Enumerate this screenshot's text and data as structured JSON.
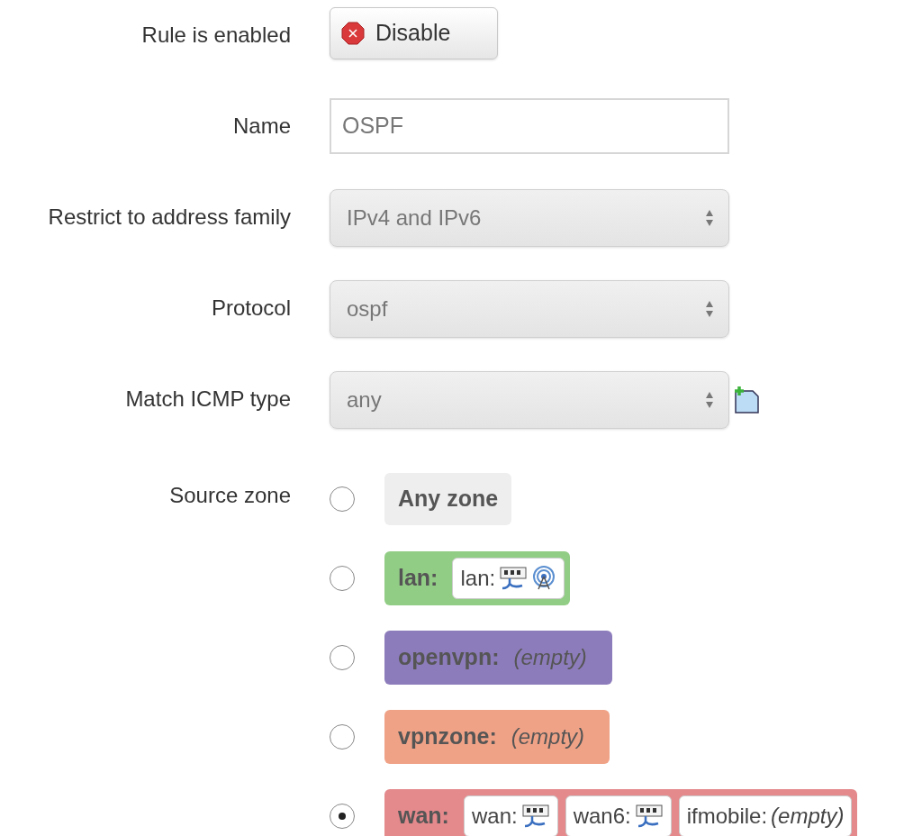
{
  "fields": [
    {
      "kind": "button",
      "label": "Rule is enabled",
      "button": "Disable"
    },
    {
      "kind": "text",
      "label": "Name",
      "value": "OSPF"
    },
    {
      "kind": "select",
      "label": "Restrict to address family",
      "value": "IPv4 and IPv6"
    },
    {
      "kind": "select",
      "label": "Protocol",
      "value": "ospf"
    },
    {
      "kind": "select",
      "label": "Match ICMP type",
      "value": "any",
      "add": true
    }
  ],
  "source_zone": {
    "label": "Source zone",
    "zones": [
      {
        "kind": "any",
        "name": "Any zone",
        "selected": false
      },
      {
        "kind": "zone",
        "name": "lan:",
        "color": "#92cd86",
        "selected": false,
        "networks": [
          {
            "name": "lan:",
            "devices": [
              {
                "kind": "ethernet"
              },
              {
                "kind": "wireless"
              }
            ]
          }
        ]
      },
      {
        "kind": "zone",
        "name": "openvpn:",
        "color": "#8d7cbb",
        "selected": false,
        "empty": "(empty)"
      },
      {
        "kind": "zone",
        "name": "vpnzone:",
        "color": "#f0a287",
        "selected": false,
        "empty": "(empty)"
      },
      {
        "kind": "zone",
        "name": "wan:",
        "color": "#e4898c",
        "selected": true,
        "networks": [
          {
            "name": "wan:",
            "devices": [
              {
                "kind": "ethernet"
              }
            ]
          },
          {
            "name": "wan6:",
            "devices": [
              {
                "kind": "ethernet"
              }
            ]
          },
          {
            "name": "ifmobile:",
            "empty": "(empty)"
          }
        ]
      }
    ]
  }
}
